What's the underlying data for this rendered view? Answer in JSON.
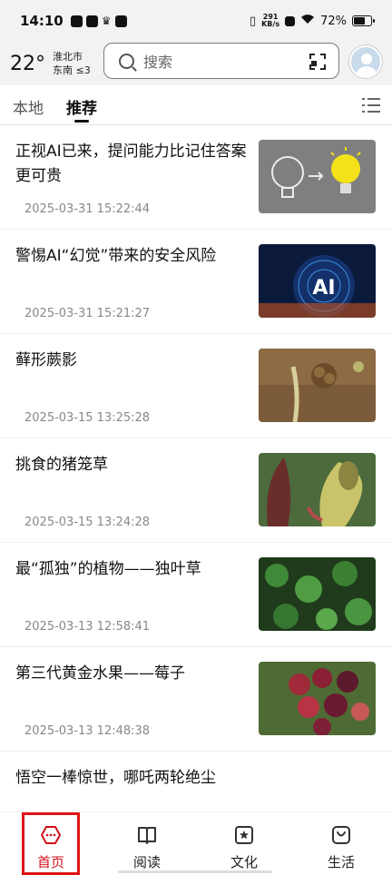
{
  "status_bar": {
    "time": "14:10",
    "net_speed_value": "291",
    "net_speed_unit": "KB/s",
    "battery_text": "72%",
    "battery_level": 0.72
  },
  "header": {
    "temperature": "22°",
    "city": "淮北市",
    "wind": "东南 ≤3",
    "search_placeholder": "搜索"
  },
  "tabs": [
    {
      "label": "本地"
    },
    {
      "label": "推荐"
    }
  ],
  "news": [
    {
      "title": "正视AI已来，提问能力比记住答案更可贵",
      "date": "2025-03-31 15:22:44",
      "thumb": "lightbulb-image"
    },
    {
      "title": "警惕AI“幻觉”带来的安全风险",
      "date": "2025-03-31 15:21:27",
      "thumb": "ai-globe-image"
    },
    {
      "title": "藓形蕨影",
      "date": "2025-03-15 13:25:28",
      "thumb": "fern-image"
    },
    {
      "title": "挑食的猪笼草",
      "date": "2025-03-15 13:24:28",
      "thumb": "pitcher-plant-image"
    },
    {
      "title": "最“孤独”的植物——独叶草",
      "date": "2025-03-13 12:58:41",
      "thumb": "clover-image"
    },
    {
      "title": "第三代黄金水果——莓子",
      "date": "2025-03-13 12:48:38",
      "thumb": "berry-image"
    },
    {
      "title": "悟空一棒惊世，哪吒两轮绝尘",
      "date": "",
      "thumb": ""
    }
  ],
  "bottom_nav": [
    {
      "label": "首页",
      "icon": "home-hexagon-icon",
      "active": true
    },
    {
      "label": "阅读",
      "icon": "book-icon",
      "active": false
    },
    {
      "label": "文化",
      "icon": "star-badge-icon",
      "active": false
    },
    {
      "label": "生活",
      "icon": "bag-icon",
      "active": false
    }
  ],
  "colors": {
    "accent": "#d0121b",
    "header_bg": "#f2f2f2"
  }
}
